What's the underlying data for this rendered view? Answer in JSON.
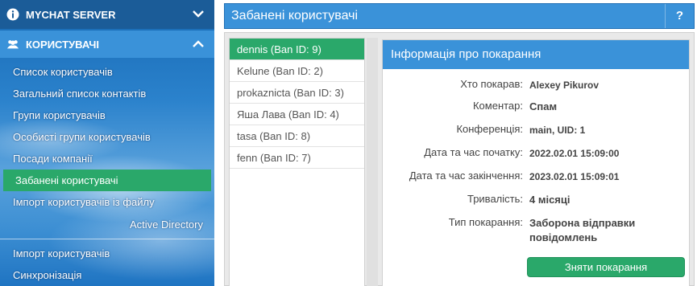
{
  "sidebar": {
    "server_label": "MYCHAT SERVER",
    "users_label": "КОРИСТУВАЧІ",
    "items": [
      {
        "label": "Список користувачів"
      },
      {
        "label": "Загальний список контактів"
      },
      {
        "label": "Групи користувачів"
      },
      {
        "label": "Особисті групи користувачів"
      },
      {
        "label": "Посади компанії"
      },
      {
        "label": "Забанені користувачі"
      },
      {
        "label": "Імпорт користувачів із файлу"
      }
    ],
    "section_label": "Active Directory",
    "ad_items": [
      {
        "label": "Імпорт користувачів"
      },
      {
        "label": "Синхронізація"
      }
    ]
  },
  "header": {
    "title": "Забанені користувачі",
    "help_label": "?"
  },
  "ban_list": [
    {
      "label": "dennis (Ban ID: 9)"
    },
    {
      "label": "Kelune (Ban ID: 2)"
    },
    {
      "label": "prokaznicta (Ban ID: 3)"
    },
    {
      "label": "Яша Лава (Ban ID: 4)"
    },
    {
      "label": "tasa (Ban ID: 8)"
    },
    {
      "label": "fenn (Ban ID: 7)"
    }
  ],
  "info": {
    "title": "Інформація про покарання",
    "rows": [
      {
        "key": "Хто покарав:",
        "value": "Alexey Pikurov"
      },
      {
        "key": "Коментар:",
        "value": "Спам"
      },
      {
        "key": "Конференція:",
        "value": "main, UID: 1"
      },
      {
        "key": "Дата та час початку:",
        "value": "2022.02.01 15:09:00"
      },
      {
        "key": "Дата та час закінчення:",
        "value": "2023.02.01 15:09:01"
      },
      {
        "key": "Тривалість:",
        "value": "4 місяці"
      },
      {
        "key": "Тип покарання:",
        "value": "Заборона відправки повідомлень"
      }
    ],
    "unban_label": "Зняти покарання"
  },
  "colors": {
    "accent_blue": "#3a92d9",
    "active_green": "#2aa86a",
    "sidebar_dark": "#1b5c98"
  }
}
